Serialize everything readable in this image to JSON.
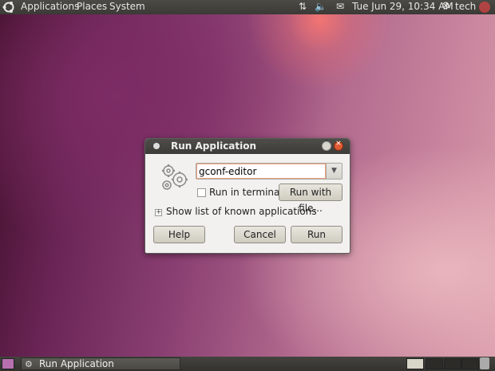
{
  "top_panel": {
    "menus": [
      "Applications",
      "Places",
      "System"
    ],
    "clock": "Tue Jun 29, 10:34 AM",
    "user": "tech",
    "tray_icons": [
      "network-icon",
      "volume-icon",
      "mail-icon"
    ]
  },
  "dialog": {
    "title": "Run Application",
    "command_value": "gconf-editor",
    "run_in_terminal_label": "Run in terminal",
    "run_in_terminal_checked": false,
    "run_with_file_label": "Run with file...",
    "expander_label": "Show list of known applications",
    "help_label": "Help",
    "cancel_label": "Cancel",
    "run_label": "Run"
  },
  "bottom_panel": {
    "task_label": "Run Application"
  }
}
